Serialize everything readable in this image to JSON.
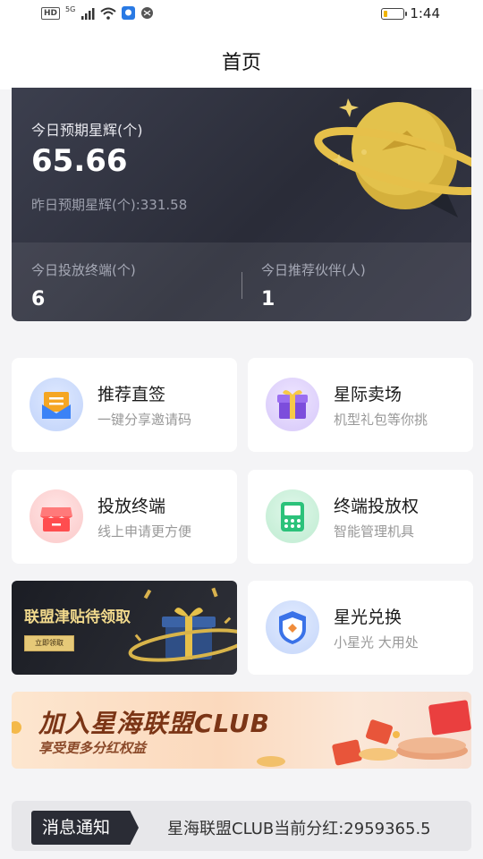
{
  "status_bar": {
    "hd": "HD",
    "network": "5G",
    "time": "1:44",
    "battery_level": 0.2
  },
  "header": {
    "title": "首页"
  },
  "hero": {
    "today_label": "今日预期星辉(个)",
    "today_value": "65.66",
    "yesterday_text": "昨日预期星辉(个):331.58",
    "stats": [
      {
        "label": "今日投放终端(个)",
        "value": "6"
      },
      {
        "label": "今日推荐伙伴(人)",
        "value": "1"
      }
    ]
  },
  "menu": [
    {
      "title": "推荐直签",
      "subtitle": "一键分享邀请码",
      "icon": "envelope-icon"
    },
    {
      "title": "星际卖场",
      "subtitle": "机型礼包等你挑",
      "icon": "gift-box-icon"
    },
    {
      "title": "投放终端",
      "subtitle": "线上申请更方便",
      "icon": "storefront-icon"
    },
    {
      "title": "终端投放权",
      "subtitle": "智能管理机具",
      "icon": "pos-terminal-icon"
    },
    {
      "title": "星光兑换",
      "subtitle": "小星光  大用处",
      "icon": "exchange-shield-icon"
    }
  ],
  "promo_subsidy": {
    "title": "联盟津贴待领取",
    "button": "立即领取"
  },
  "promo_club": {
    "title": "加入星海联盟CLUB",
    "subtitle": "享受更多分红权益"
  },
  "notice": {
    "tag": "消息通知",
    "text": "星海联盟CLUB当前分红:2959365.5"
  },
  "colors": {
    "hero_bg": "#2f313d",
    "accent_gold": "#e6c04a",
    "club_text": "#7b3516"
  }
}
